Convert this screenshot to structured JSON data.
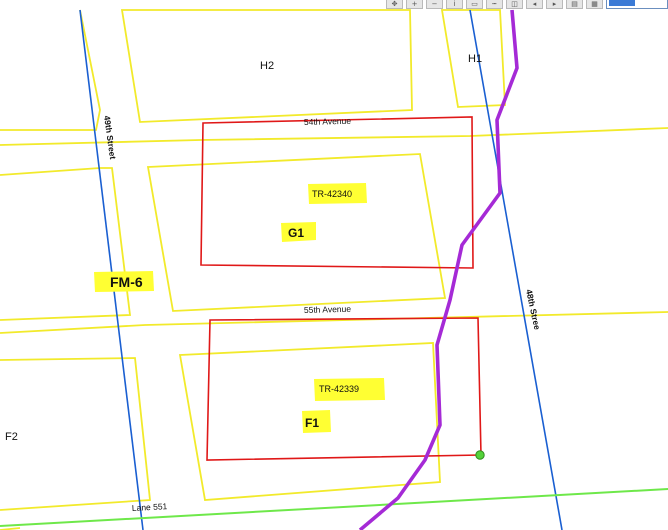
{
  "toolbar": {
    "icons": [
      "pan-icon",
      "zoom-in-icon",
      "zoom-out-icon",
      "identify-icon",
      "select-icon",
      "measure-icon",
      "full-extent-icon",
      "back-icon",
      "forward-icon",
      "print-icon",
      "export-icon"
    ],
    "scale_selected": ""
  },
  "labels": {
    "h2": "H2",
    "h1": "H1",
    "g1": "G1",
    "f1": "F1",
    "f2": "F2",
    "fm6": "FM-6",
    "tr_42340": "TR-42340",
    "tr_42339": "TR-42339",
    "street_49th": "49th Street",
    "street_48th": "48th Stree",
    "ave_54th": "54th Avenue",
    "ave_55th": "55th Avenue",
    "lane_551": "Lane 551"
  },
  "colors": {
    "parcel": "#f2ea2b",
    "tract": "#e01818",
    "street": "#1a5fd1",
    "route": "#a52ad6",
    "lane": "#6ee84a",
    "highlight": "#ffff33",
    "vertex": "#54d23a"
  }
}
